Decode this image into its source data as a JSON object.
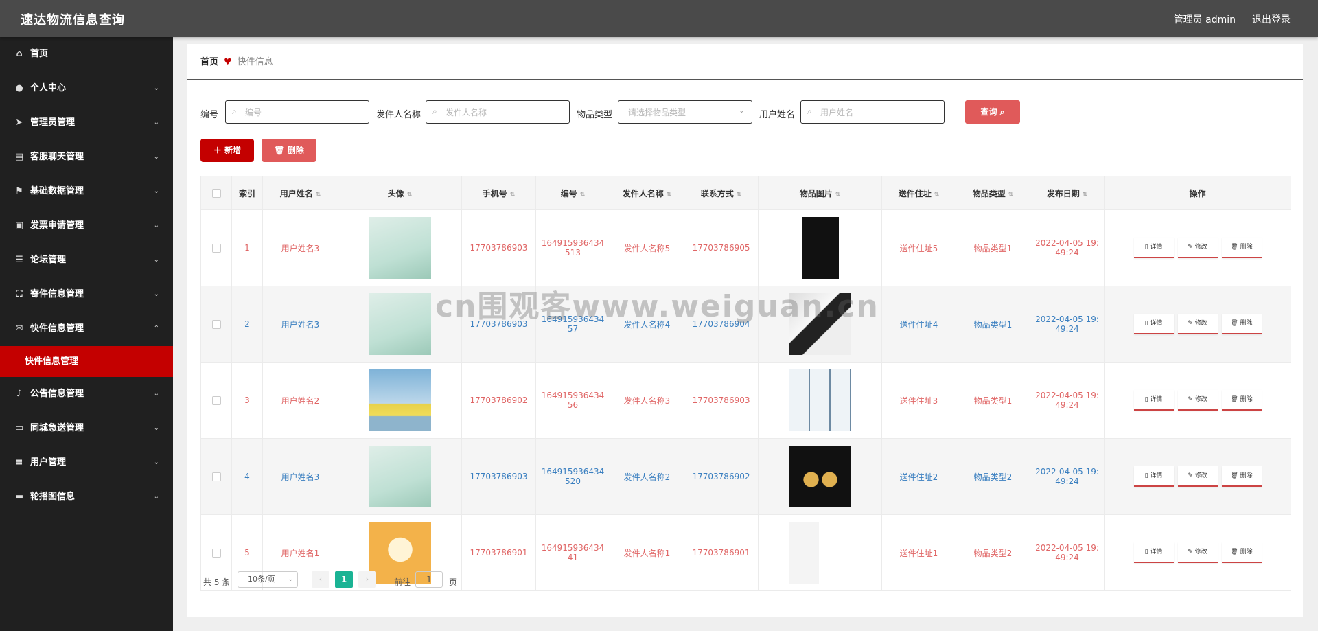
{
  "app": {
    "title": "速达物流信息查询",
    "user": "管理员 admin",
    "logout": "退出登录"
  },
  "sidebar": {
    "items": [
      {
        "label": "首页",
        "icon": "home-icon",
        "glyph": "⌂",
        "chevron": ""
      },
      {
        "label": "个人中心",
        "icon": "user-icon",
        "glyph": "●",
        "chevron": "⌄"
      },
      {
        "label": "管理员管理",
        "icon": "send-icon",
        "glyph": "➤",
        "chevron": "⌄"
      },
      {
        "label": "客服聊天管理",
        "icon": "chat-card-icon",
        "glyph": "▤",
        "chevron": "⌄"
      },
      {
        "label": "基础数据管理",
        "icon": "flag-icon",
        "glyph": "⚑",
        "chevron": "⌄"
      },
      {
        "label": "发票申请管理",
        "icon": "briefcase-icon",
        "glyph": "▣",
        "chevron": "⌄"
      },
      {
        "label": "论坛管理",
        "icon": "sliders-icon",
        "glyph": "☰",
        "chevron": "⌄"
      },
      {
        "label": "寄件信息管理",
        "icon": "fullscreen-icon",
        "glyph": "⛶",
        "chevron": "⌄"
      },
      {
        "label": "快件信息管理",
        "icon": "mail-icon",
        "glyph": "✉",
        "chevron": "⌃"
      }
    ],
    "submenu": {
      "label": "快件信息管理"
    },
    "items_after": [
      {
        "label": "公告信息管理",
        "icon": "bell-icon",
        "glyph": "♪",
        "chevron": "⌄"
      },
      {
        "label": "同城急送管理",
        "icon": "message-icon",
        "glyph": "▭",
        "chevron": "⌄"
      },
      {
        "label": "用户管理",
        "icon": "list-icon",
        "glyph": "≡",
        "chevron": "⌄"
      },
      {
        "label": "轮播图信息",
        "icon": "comment-icon",
        "glyph": "▬",
        "chevron": "⌄"
      }
    ]
  },
  "breadcrumb": {
    "home": "首页",
    "current": "快件信息"
  },
  "search": {
    "fields": [
      {
        "label": "编号",
        "placeholder": "编号"
      },
      {
        "label": "发件人名称",
        "placeholder": "发件人名称"
      },
      {
        "label": "物品类型",
        "placeholder": "请选择物品类型"
      },
      {
        "label": "用户姓名",
        "placeholder": "用户姓名"
      }
    ],
    "query": "查询"
  },
  "toolbar": {
    "add": "新增",
    "delete": "删除"
  },
  "table": {
    "headers": [
      "索引",
      "用户姓名",
      "头像",
      "手机号",
      "编号",
      "发件人名称",
      "联系方式",
      "物品图片",
      "送件住址",
      "物品类型",
      "发布日期",
      "操作"
    ],
    "ops": {
      "detail": "详情",
      "edit": "修改",
      "delete": "删除"
    },
    "rows": [
      {
        "index": "1",
        "name": "用户姓名3",
        "phone": "17703786903",
        "code": "164915936434513",
        "sender": "发件人名称5",
        "contact": "17703786905",
        "address": "送件住址5",
        "type": "物品类型1",
        "date": "2022-04-05 19:49:24"
      },
      {
        "index": "2",
        "name": "用户姓名3",
        "phone": "17703786903",
        "code": "16491593643457",
        "sender": "发件人名称4",
        "contact": "17703786904",
        "address": "送件住址4",
        "type": "物品类型1",
        "date": "2022-04-05 19:49:24"
      },
      {
        "index": "3",
        "name": "用户姓名2",
        "phone": "17703786902",
        "code": "16491593643456",
        "sender": "发件人名称3",
        "contact": "17703786903",
        "address": "送件住址3",
        "type": "物品类型1",
        "date": "2022-04-05 19:49:24"
      },
      {
        "index": "4",
        "name": "用户姓名3",
        "phone": "17703786903",
        "code": "164915936434520",
        "sender": "发件人名称2",
        "contact": "17703786902",
        "address": "送件住址2",
        "type": "物品类型2",
        "date": "2022-04-05 19:49:24"
      },
      {
        "index": "5",
        "name": "用户姓名1",
        "phone": "17703786901",
        "code": "16491593643441",
        "sender": "发件人名称1",
        "contact": "17703786901",
        "address": "送件住址1",
        "type": "物品类型2",
        "date": "2022-04-05 19:49:24"
      }
    ]
  },
  "pager": {
    "total": "共 5 条",
    "size": "10条/页",
    "page": "1",
    "goto": "前往",
    "goto_value": "1",
    "ye": "页"
  },
  "watermark": "cn围观客www.weiguan.cn"
}
